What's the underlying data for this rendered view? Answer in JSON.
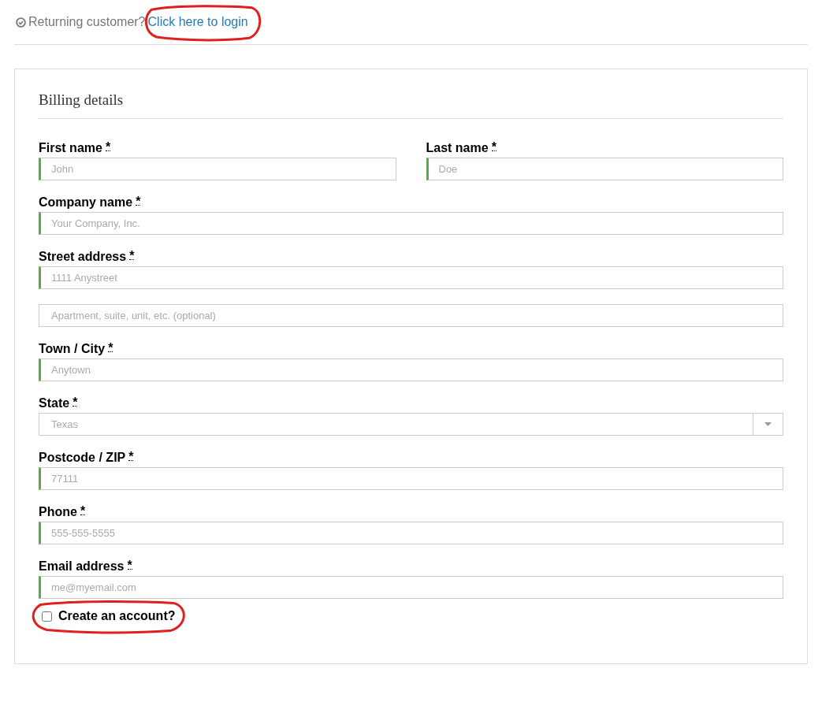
{
  "notice": {
    "text": "Returning customer?",
    "link": {
      "label": "Click here to login",
      "highlighted": true
    }
  },
  "billing": {
    "title": "Billing details",
    "rows": [
      {
        "fields": [
          {
            "kind": "text",
            "label": "First name",
            "required_mark": "*",
            "placeholder": "John",
            "validated": true
          },
          {
            "kind": "text",
            "label": "Last name",
            "required_mark": "*",
            "placeholder": "Doe",
            "validated": true
          }
        ]
      },
      {
        "fields": [
          {
            "kind": "text",
            "label": "Company name",
            "required_mark": "*",
            "placeholder": "Your Company, Inc.",
            "validated": true
          }
        ]
      },
      {
        "fields": [
          {
            "kind": "text",
            "label": "Street address",
            "required_mark": "*",
            "placeholder": "1111 Anystreet",
            "validated": true
          }
        ]
      },
      {
        "fields": [
          {
            "kind": "text",
            "placeholder": "Apartment, suite, unit, etc. (optional)",
            "validated": false
          }
        ]
      },
      {
        "fields": [
          {
            "kind": "text",
            "label": "Town / City",
            "required_mark": "*",
            "placeholder": "Anytown",
            "validated": true
          }
        ]
      },
      {
        "fields": [
          {
            "kind": "select",
            "label": "State",
            "required_mark": "*",
            "value": "Texas",
            "validated": false
          }
        ]
      },
      {
        "fields": [
          {
            "kind": "text",
            "label": "Postcode / ZIP",
            "required_mark": "*",
            "placeholder": "77111",
            "validated": true
          }
        ]
      },
      {
        "fields": [
          {
            "kind": "text",
            "label": "Phone",
            "required_mark": "*",
            "placeholder": "555-555-5555",
            "validated": true
          }
        ]
      },
      {
        "fields": [
          {
            "kind": "text",
            "label": "Email address",
            "required_mark": "*",
            "placeholder": "me@myemail.com",
            "validated": true
          }
        ]
      }
    ],
    "create_account": {
      "label": "Create an account?",
      "checked": false,
      "highlighted": true
    }
  }
}
